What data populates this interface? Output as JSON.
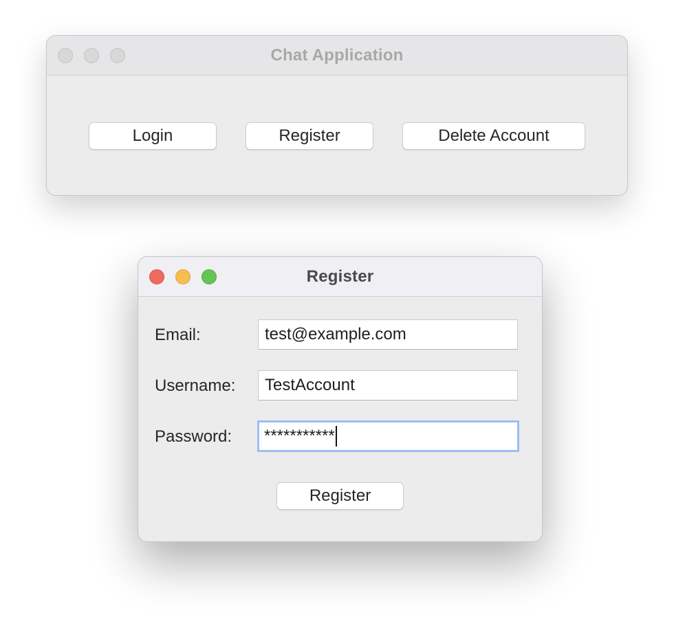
{
  "main_window": {
    "title": "Chat Application",
    "buttons": {
      "login": "Login",
      "register": "Register",
      "delete_account": "Delete Account"
    }
  },
  "register_dialog": {
    "title": "Register",
    "email": {
      "label": "Email:",
      "value": "test@example.com"
    },
    "username": {
      "label": "Username:",
      "value": "TestAccount"
    },
    "password": {
      "label": "Password:",
      "value": "***********"
    },
    "submit_label": "Register"
  },
  "colors": {
    "close": "#ee6a5f",
    "minimize": "#f5be4f",
    "maximize": "#62c554",
    "focus_ring": "#9dbef0"
  }
}
